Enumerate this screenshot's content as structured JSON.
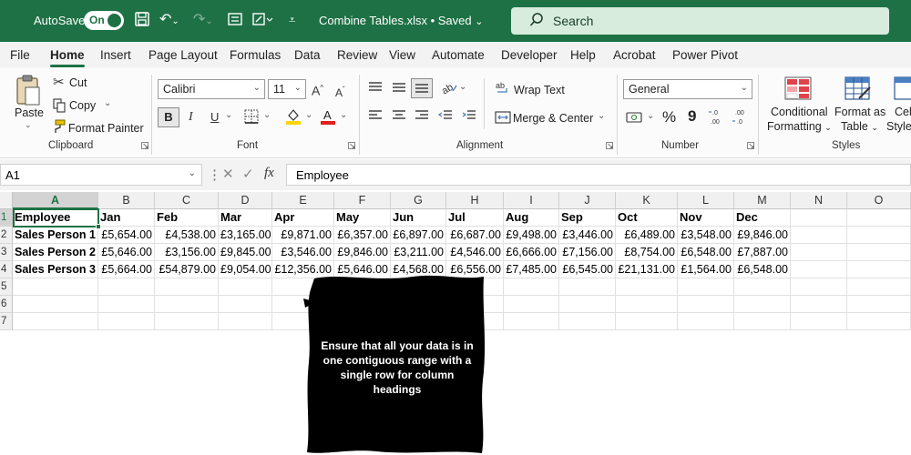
{
  "titlebar": {
    "autosave_label": "AutoSave",
    "toggle_label": "On",
    "file_title": "Combine Tables.xlsx • Saved",
    "search_placeholder": "Search"
  },
  "menu": {
    "tabs": [
      "File",
      "Home",
      "Insert",
      "Page Layout",
      "Formulas",
      "Data",
      "Review",
      "View",
      "Automate",
      "Developer",
      "Help",
      "Acrobat",
      "Power Pivot"
    ],
    "active": "Home"
  },
  "ribbon": {
    "clipboard": {
      "paste": "Paste",
      "cut": "Cut",
      "copy": "Copy",
      "format_painter": "Format Painter",
      "label": "Clipboard"
    },
    "font": {
      "font_name": "Calibri",
      "font_size": "11",
      "label": "Font",
      "bold": "B",
      "italic": "I",
      "underline": "U"
    },
    "alignment": {
      "wrap_text": "Wrap Text",
      "merge_center": "Merge & Center",
      "label": "Alignment"
    },
    "number": {
      "format": "General",
      "percent": "%",
      "comma": "9",
      "label": "Number"
    },
    "styles": {
      "conditional_line1": "Conditional",
      "conditional_line2": "Formatting",
      "format_table_line1": "Format as",
      "format_table_line2": "Table",
      "cell_styles_line1": "Cell",
      "cell_styles_line2": "Styles",
      "label": "Styles"
    }
  },
  "formula_bar": {
    "name_box": "A1",
    "fx": "fx",
    "content": "Employee"
  },
  "sheet": {
    "columns": [
      "A",
      "B",
      "C",
      "D",
      "E",
      "F",
      "G",
      "H",
      "I",
      "J",
      "K",
      "L",
      "M",
      "N",
      "O"
    ],
    "row_numbers": [
      "1",
      "2",
      "3",
      "4",
      "5",
      "6",
      "7"
    ],
    "header_row": [
      "Employee",
      "Jan",
      "Feb",
      "Mar",
      "Apr",
      "May",
      "Jun",
      "Jul",
      "Aug",
      "Sep",
      "Oct",
      "Nov",
      "Dec"
    ],
    "rows": [
      [
        "Sales Person 1",
        "£5,654.00",
        "£4,538.00",
        "£3,165.00",
        "£9,871.00",
        "£6,357.00",
        "£6,897.00",
        "£6,687.00",
        "£9,498.00",
        "£3,446.00",
        "£6,489.00",
        "£3,548.00",
        "£9,846.00"
      ],
      [
        "Sales Person 2",
        "£5,646.00",
        "£3,156.00",
        "£9,845.00",
        "£3,546.00",
        "£9,846.00",
        "£3,211.00",
        "£4,546.00",
        "£6,666.00",
        "£7,156.00",
        "£8,754.00",
        "£6,548.00",
        "£7,887.00"
      ],
      [
        "Sales Person 3",
        "£5,664.00",
        "£54,879.00",
        "£9,054.00",
        "£12,356.00",
        "£5,646.00",
        "£4,568.00",
        "£6,556.00",
        "£7,485.00",
        "£6,545.00",
        "£21,131.00",
        "£1,564.00",
        "£6,548.00"
      ]
    ]
  },
  "callout": {
    "text": "Ensure that all your data is in one contiguous range with a single row for column headings"
  }
}
